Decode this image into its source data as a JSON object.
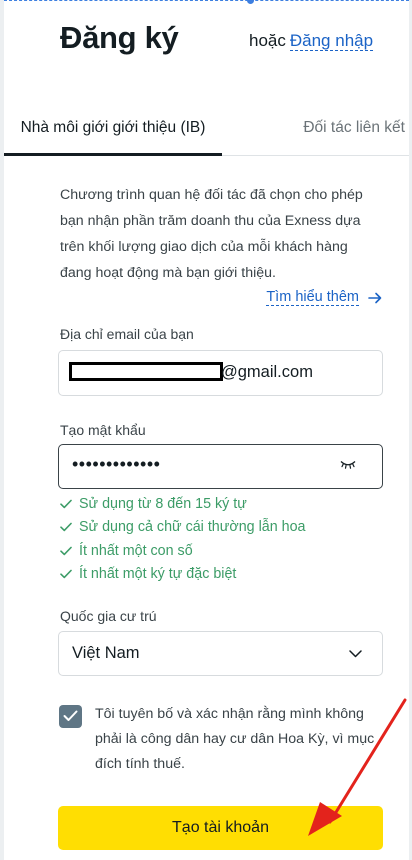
{
  "header": {
    "title": "Đăng ký",
    "or_text": "hoặc",
    "login_link": "Đăng nhập"
  },
  "tabs": [
    {
      "label": "Nhà môi giới giới thiệu (IB)",
      "active": true
    },
    {
      "label": "Đối tác liên kết",
      "active": false
    }
  ],
  "description": "Chương trình quan hệ đối tác đã chọn cho phép bạn nhận phần trăm doanh thu của Exness dựa trên khối lượng giao dịch của mỗi khách hàng đang hoạt động mà bạn giới thiệu.",
  "learn_more": "Tìm hiểu thêm",
  "email": {
    "label": "Địa chỉ email của bạn",
    "value_suffix": "@gmail.com"
  },
  "password": {
    "label": "Tạo mật khẩu",
    "masked_value": "•••••••••••••"
  },
  "password_rules": [
    "Sử dụng từ 8 đến 15 ký tự",
    "Sử dụng cả chữ cái thường lẫn hoa",
    "Ít nhất một con số",
    "Ít nhất một ký tự đặc biệt"
  ],
  "country": {
    "label": "Quốc gia cư trú",
    "selected": "Việt Nam"
  },
  "consent": {
    "checked": true,
    "text": "Tôi tuyên bố và xác nhận rằng mình không phải là công dân hay cư dân Hoa Kỳ, vì mục đích tính thuế."
  },
  "submit_label": "Tạo tài khoản",
  "colors": {
    "accent_yellow": "#ffde02",
    "link_blue": "#1b63c6",
    "success_green": "#3c9c67",
    "checkbox_gray": "#5f7685",
    "annotation_red": "#e3231c"
  },
  "icons": {
    "learn_more": "arrow-right-icon",
    "password_toggle": "eye-closed-icon",
    "rule": "check-icon",
    "select": "chevron-down-icon",
    "checkbox": "checkmark-icon",
    "annotation": "red-arrow-annotation"
  }
}
